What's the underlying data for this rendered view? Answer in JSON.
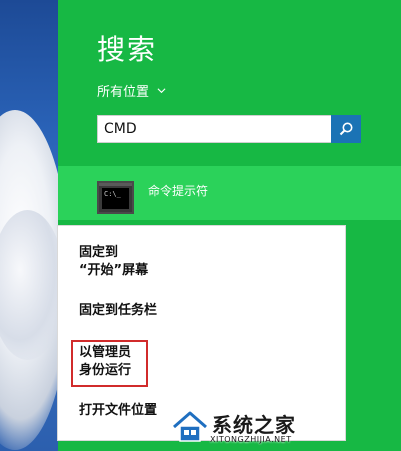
{
  "search_pane": {
    "title": "搜索",
    "scope_label": "所有位置",
    "query": "CMD",
    "colors": {
      "pane": "#17b844",
      "selected_result": "#2bd25a",
      "search_button": "#1b73b5"
    }
  },
  "result": {
    "label": "命令提示符",
    "icon": "command-prompt-icon",
    "icon_text": "C:\\_"
  },
  "context_menu": {
    "items": [
      {
        "line1": "固定到",
        "line2": "“开始”屏幕"
      },
      {
        "line1": "固定到任务栏"
      },
      {
        "line1": "以管理员",
        "line2": "身份运行",
        "highlighted": true
      },
      {
        "line1": "打开文件位置"
      }
    ],
    "highlight_color": "#d12b2b"
  },
  "watermark": {
    "name": "系统之家",
    "url": "XITONGZHIJIA.NET"
  }
}
